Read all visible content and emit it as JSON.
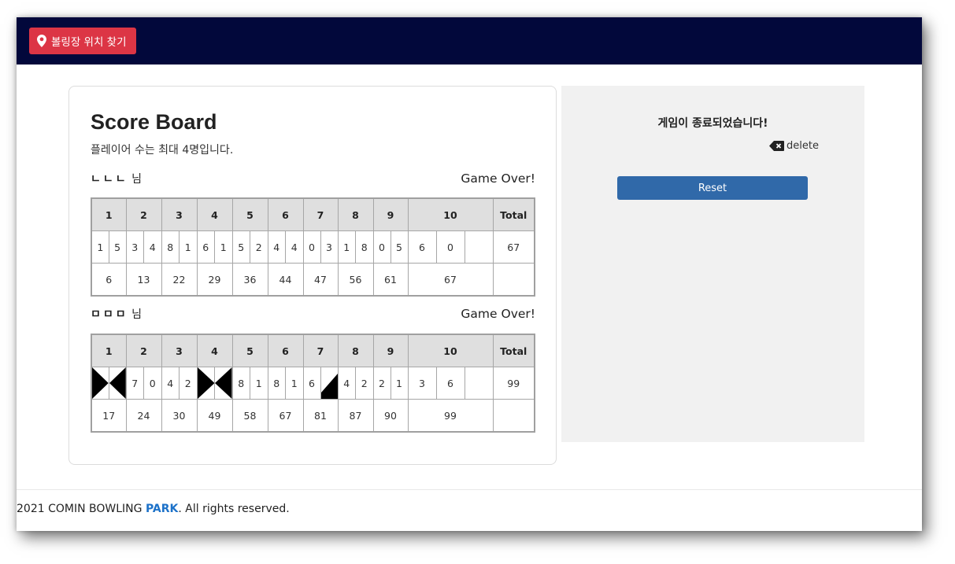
{
  "nav": {
    "locate_button_label": "볼링장 위치 찾기",
    "locate_icon": "map-pin-icon"
  },
  "scoreboard": {
    "title": "Score Board",
    "subtitle": "플레이어 수는 최대 4명입니다.",
    "headers": [
      "1",
      "2",
      "3",
      "4",
      "5",
      "6",
      "7",
      "8",
      "9",
      "10",
      "Total"
    ],
    "players": [
      {
        "name": "ㄴㄴㄴ",
        "suffix": "님",
        "status": "Game Over!",
        "frames": [
          [
            "1",
            "5"
          ],
          [
            "3",
            "4"
          ],
          [
            "8",
            "1"
          ],
          [
            "6",
            "1"
          ],
          [
            "5",
            "2"
          ],
          [
            "4",
            "4"
          ],
          [
            "0",
            "3"
          ],
          [
            "1",
            "8"
          ],
          [
            "0",
            "5"
          ],
          [
            "6",
            "0",
            ""
          ]
        ],
        "cumulative": [
          "6",
          "13",
          "22",
          "29",
          "36",
          "44",
          "47",
          "56",
          "61",
          "67"
        ],
        "total": "67"
      },
      {
        "name": "ㅁㅁㅁ",
        "suffix": "님",
        "status": "Game Over!",
        "frames": [
          [
            "strike"
          ],
          [
            "7",
            "0"
          ],
          [
            "4",
            "2"
          ],
          [
            "strike"
          ],
          [
            "8",
            "1"
          ],
          [
            "8",
            "1"
          ],
          [
            "6",
            "spare"
          ],
          [
            "4",
            "2"
          ],
          [
            "2",
            "1"
          ],
          [
            "3",
            "6",
            ""
          ]
        ],
        "cumulative": [
          "17",
          "24",
          "30",
          "49",
          "58",
          "67",
          "81",
          "87",
          "90",
          "99"
        ],
        "total": "99"
      }
    ]
  },
  "panel": {
    "message": "게임이 종료되었습니다!",
    "delete_label": "delete",
    "delete_icon": "backspace-icon",
    "reset_label": "Reset"
  },
  "footer": {
    "prefix": "2021 COMIN BOWLING ",
    "brand": "PARK",
    "suffix": ". All rights reserved."
  },
  "colors": {
    "navbar": "#02083b",
    "locate_button": "#dc3545",
    "reset_button": "#3069a9",
    "brand_link": "#1d72c9",
    "panel_bg": "#f1f1f1"
  }
}
